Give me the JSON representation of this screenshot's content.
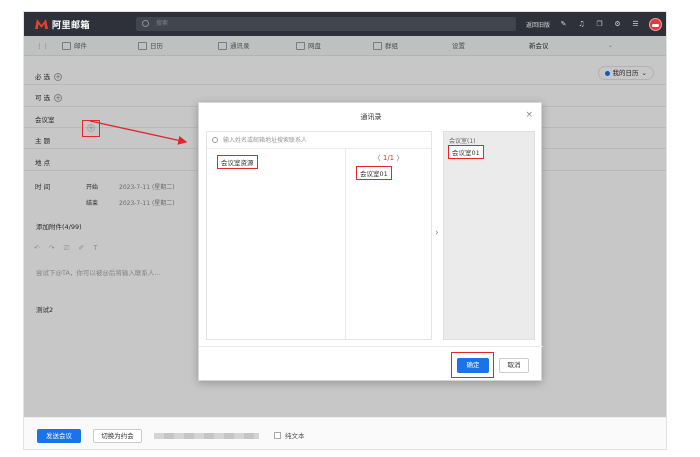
{
  "topbar": {
    "brand": "阿里邮箱",
    "search_placeholder": "搜索",
    "link_text": "返回旧版",
    "icons": [
      "brush-icon",
      "bell-icon",
      "window-icon",
      "gear-icon",
      "chat-icon",
      "avatar"
    ]
  },
  "tabs": [
    {
      "label": "邮件",
      "icon": "mail-icon"
    },
    {
      "label": "日历",
      "icon": "calendar-icon"
    },
    {
      "label": "通讯录",
      "icon": "contacts-icon"
    },
    {
      "label": "网盘",
      "icon": "drive-icon"
    },
    {
      "label": "群组",
      "icon": "group-icon"
    },
    {
      "label": "设置",
      "icon": ""
    },
    {
      "label": "新会议",
      "icon": ""
    }
  ],
  "form": {
    "required_label": "必 选",
    "optional_label": "可 选",
    "room_label": "会议室",
    "subject_label": "主 题",
    "location_label": "地 点",
    "time_label": "时 间",
    "start_label": "开始",
    "end_label": "结束",
    "start_value": "2023-7-11 (星期二)",
    "end_value": "2023-7-11 (星期二)",
    "calendar_selector": "我的日历",
    "recurrence": "添加附件(4/99)",
    "body_placeholder": "尝试下@TA，你可以被@后将输入联系人...",
    "body_text": "测试2"
  },
  "bottom": {
    "send_label": "发送会议",
    "switch_label": "切换为约会",
    "plain_text_label": "纯文本"
  },
  "modal": {
    "title": "通讯录",
    "search_placeholder": "输入姓名或邮箱地址搜索联系人",
    "left_item": "会议室资源",
    "pager_prev": "〈",
    "pager_text": "1/1",
    "pager_next": "〉",
    "middle_item": "会议室01",
    "selected_header": "会议室(1)",
    "selected_item": "会议室01",
    "ok_label": "确定",
    "cancel_label": "取消",
    "close_glyph": "×",
    "move_glyph": "›"
  }
}
